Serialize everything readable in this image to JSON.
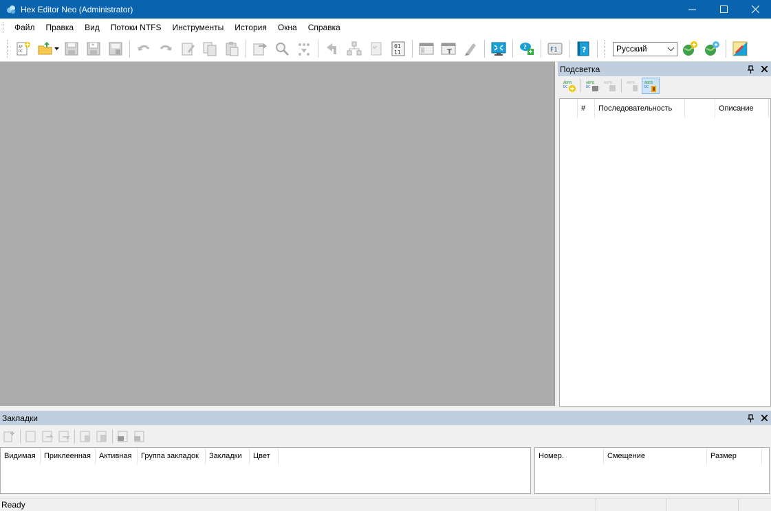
{
  "window": {
    "title": "Hex Editor Neo (Administrator)",
    "minimize_icon": "minimize-icon",
    "maximize_icon": "maximize-icon",
    "close_icon": "close-icon"
  },
  "menu": {
    "items": [
      "Файл",
      "Правка",
      "Вид",
      "Потоки NTFS",
      "Инструменты",
      "История",
      "Окна",
      "Справка"
    ]
  },
  "toolbar": {
    "language": "Русский"
  },
  "highlight_panel": {
    "title": "Подсветка",
    "columns": [
      "",
      "#",
      "Последовательность",
      "",
      "Описание"
    ]
  },
  "bookmarks_panel": {
    "title": "Закладки",
    "left_columns": [
      "Видимая",
      "Приклеенная",
      "Активная",
      "Группа закладок",
      "Закладки",
      "Цвет"
    ],
    "right_columns": [
      "Номер.",
      "Смещение",
      "Размер"
    ]
  },
  "status": {
    "text": "Ready"
  },
  "colors": {
    "titlebar": "#0a64ad",
    "panel_header": "#bfcfe0",
    "editor_background": "#ababab"
  }
}
